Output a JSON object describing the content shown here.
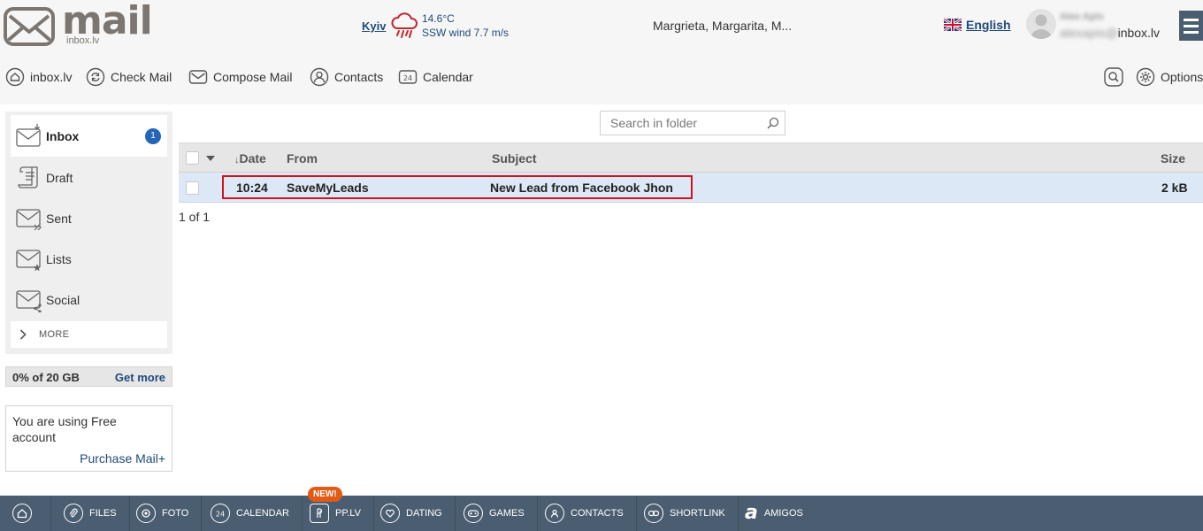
{
  "brand": {
    "name": "mail",
    "sub": "inbox.lv"
  },
  "weather": {
    "city": "Kyiv",
    "temperature": "14.6°C",
    "wind": "SSW wind 7.7 m/s",
    "icon": "rain-cloud-icon"
  },
  "name_days": "Margrieta, Margarita, M...",
  "language": {
    "label": "English",
    "icon": "uk-flag-icon"
  },
  "user": {
    "name": "Alex Apis",
    "email_local": "alexapis@",
    "email_domain": "inbox.lv"
  },
  "toolbar": {
    "home": "inbox.lv",
    "check": "Check Mail",
    "compose": "Compose Mail",
    "contacts": "Contacts",
    "calendar": "Calendar",
    "options": "Options"
  },
  "folders": [
    {
      "label": "Inbox",
      "badge": "1",
      "active": true
    },
    {
      "label": "Draft"
    },
    {
      "label": "Sent"
    },
    {
      "label": "Lists"
    },
    {
      "label": "Social"
    }
  ],
  "more_label": "MORE",
  "storage": {
    "usage": "0% of 20 GB",
    "get_more": "Get more",
    "used_fraction": 0
  },
  "account": {
    "text": "You are using Free account",
    "purchase": "Purchase Mail+"
  },
  "search": {
    "placeholder": "Search in folder"
  },
  "columns": {
    "date": "Date",
    "from": "From",
    "subject": "Subject",
    "size": "Size"
  },
  "messages": [
    {
      "time": "10:24",
      "from": "SaveMyLeads",
      "subject": "New Lead from Facebook Jhon",
      "size": "2 kB"
    }
  ],
  "pager": "1 of 1",
  "bottom_nav": {
    "files": "FILES",
    "foto": "FOTO",
    "calendar": "CALENDAR",
    "pplv": "PP.LV",
    "dating": "DATING",
    "games": "GAMES",
    "contacts": "CONTACTS",
    "shortlink": "SHORTLINK",
    "amigos": "AMIGOS",
    "new_badge": "NEW!"
  },
  "colors": {
    "accent": "#2465b9",
    "link": "#1f4a7a",
    "bottom_bar": "#4b5d70",
    "highlight": "#d4121c",
    "selected_row": "#dde8f6"
  }
}
